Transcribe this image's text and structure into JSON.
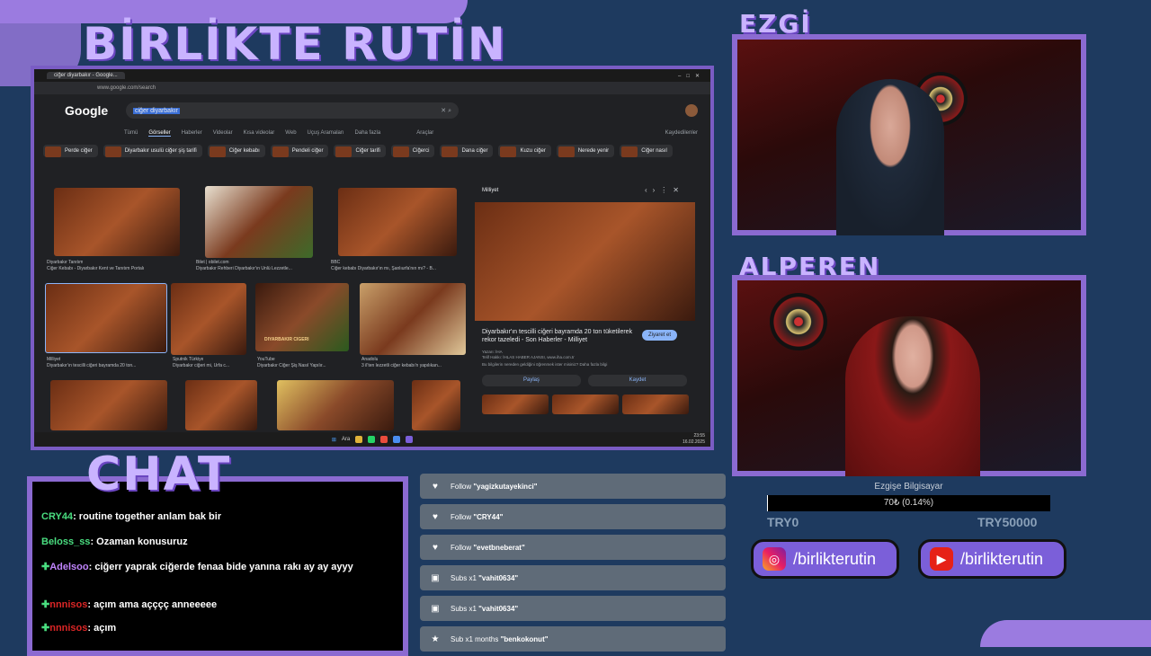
{
  "overlay": {
    "main_title": "BİRLİKTE RUTİN",
    "cam1_label": "EZGİ",
    "cam2_label": "ALPEREN",
    "chat_title": "CHAT"
  },
  "browser": {
    "tab_title": "ciğer diyarbakır - Google...",
    "url": "www.google.com/search",
    "search_query": "ciğer diyarbakır",
    "logo": "Google",
    "tabs": [
      "Tümü",
      "Görseller",
      "Haberler",
      "Videolar",
      "Kısa videolar",
      "Web",
      "Uçuş Aramaları",
      "Daha fazla"
    ],
    "tools_label": "Araçlar",
    "saved_label": "Kaydedilenler",
    "chips": [
      "Perde ciğer",
      "Diyarbakır usulü ciğer şiş tarifi",
      "Ciğer kebabı",
      "Pendeli ciğer",
      "Ciğer tarifi",
      "Ciğerci",
      "Dana ciğer",
      "Kuzu ciğer",
      "Nerede yenir",
      "Ciğer nasıl"
    ],
    "results": [
      {
        "source": "Diyarbakır Tanıtım",
        "title": "Ciğer Kebabı - Diyarbakır Kent ve Tanıtım Portalı"
      },
      {
        "source": "Bilet | obilet.com",
        "title": "Diyarbakır Rehberi Diyarbakır'ın Ünlü Lezzetle..."
      },
      {
        "source": "BBC",
        "title": "Ciğer kebabı Diyarbakır'ın mı, Şanlıurfa'nın mı? - B..."
      },
      {
        "source": "Milliyet",
        "title": "Diyarbakır'ın tescilli ciğeri bayramda 20 ton..."
      },
      {
        "source": "Sputnik Türkiye",
        "title": "Diyarbakır ciğeri mi, Urfa c..."
      },
      {
        "source": "YouTube",
        "title": "Diyarbakır Ciğer Şiş Nasıl Yapılır..."
      },
      {
        "source": "Anadolu",
        "title": "3 il'ten lezzetli ciğer kebabı'n yapılıkan..."
      }
    ],
    "video_overlay": "DİYARBAKIR CİĞERİ",
    "panel": {
      "source": "Milliyet",
      "headline": "Diyarbakır'ın tescilli ciğeri bayramda 20 ton tüketilerek rekor tazeledi - Son Haberler - Milliyet",
      "visit_label": "Ziyaret et",
      "meta1": "Yazarı: İHA",
      "meta2": "Telif Hakkı: İHLAS HABER AJANSI, www.iha.com.tr",
      "meta3": "Bu bilgilerin nereden geldiğini öğrenmek ister misiniz? Daha fazla bilgi",
      "share_label": "Paylaş",
      "save_label": "Kaydet"
    },
    "taskbar_time": "23:55",
    "taskbar_date": "16.02.2025",
    "taskbar_search": "Ara"
  },
  "chat": {
    "messages": [
      {
        "user": "CRY44",
        "user_color": "#4ade80",
        "text": "routine together anlam bak bir",
        "badge": false
      },
      {
        "user": "Beloss_ss",
        "user_color": "#4ade80",
        "text": "Ozaman konusuruz",
        "badge": false
      },
      {
        "user": "Adelsoo",
        "user_color": "#c084fc",
        "text": "ciğerr yaprak ciğerde fenaa bide yanına rakı ay ay ayyy",
        "badge": true
      },
      {
        "user": "nnnisos",
        "user_color": "#dc2626",
        "text": "açım ama açççç anneeeee",
        "badge": true
      },
      {
        "user": "nnnisos",
        "user_color": "#dc2626",
        "text": "açım",
        "badge": true
      }
    ]
  },
  "alerts": [
    {
      "icon": "heart-icon",
      "prefix": "Follow",
      "name": "\"yagizkutayekinci\""
    },
    {
      "icon": "heart-icon",
      "prefix": "Follow",
      "name": "\"CRY44\""
    },
    {
      "icon": "heart-icon",
      "prefix": "Follow",
      "name": "\"evetbneberat\""
    },
    {
      "icon": "gift-icon",
      "prefix": "Subs x1",
      "name": "\"vahit0634\""
    },
    {
      "icon": "gift-icon",
      "prefix": "Subs x1",
      "name": "\"vahit0634\""
    },
    {
      "icon": "star-icon",
      "prefix": "Sub x1 months",
      "name": "\"benkokonut\""
    }
  ],
  "donation": {
    "label": "Ezgişe Bilgisayar",
    "text": "70₺ (0.14%)",
    "progress": 0.0014,
    "min": "TRY0",
    "max": "TRY50000"
  },
  "socials": {
    "instagram": "/birlikterutin",
    "youtube": "/birlikterutin"
  },
  "colors": {
    "accent": "#8b6ad1",
    "background": "#1e3a5f",
    "google_blue": "#8ab4f8"
  }
}
